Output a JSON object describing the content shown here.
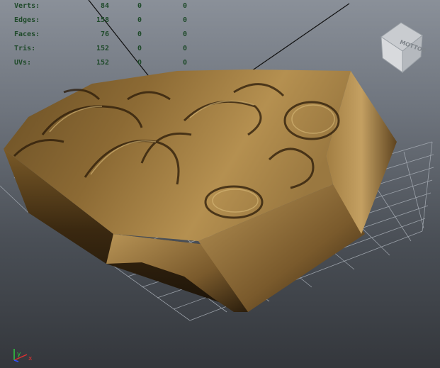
{
  "hud": {
    "rows": [
      {
        "label": "Verts:",
        "v1": "84",
        "v2": "0",
        "v3": "0"
      },
      {
        "label": "Edges:",
        "v1": "158",
        "v2": "0",
        "v3": "0"
      },
      {
        "label": "Faces:",
        "v1": "76",
        "v2": "0",
        "v3": "0"
      },
      {
        "label": "Tris:",
        "v1": "152",
        "v2": "0",
        "v3": "0"
      },
      {
        "label": "UVs:",
        "v1": "152",
        "v2": "0",
        "v3": "0"
      }
    ]
  },
  "view_cube": {
    "face_label": "BOTTOM",
    "shown_text": "MOTTOB",
    "icon": "view-cube-icon"
  },
  "axis_indicator": {
    "icon": "axis-gizmo-icon",
    "y_label": "y",
    "x_label": "x",
    "y_color": "#2ecc40",
    "x_color": "#e03030",
    "z_color": "#3050ff"
  },
  "colors": {
    "hud_text": "#1f4a2a",
    "bg_top": "#8a9099",
    "bg_bottom": "#34373c",
    "model": "#8c6a34"
  }
}
